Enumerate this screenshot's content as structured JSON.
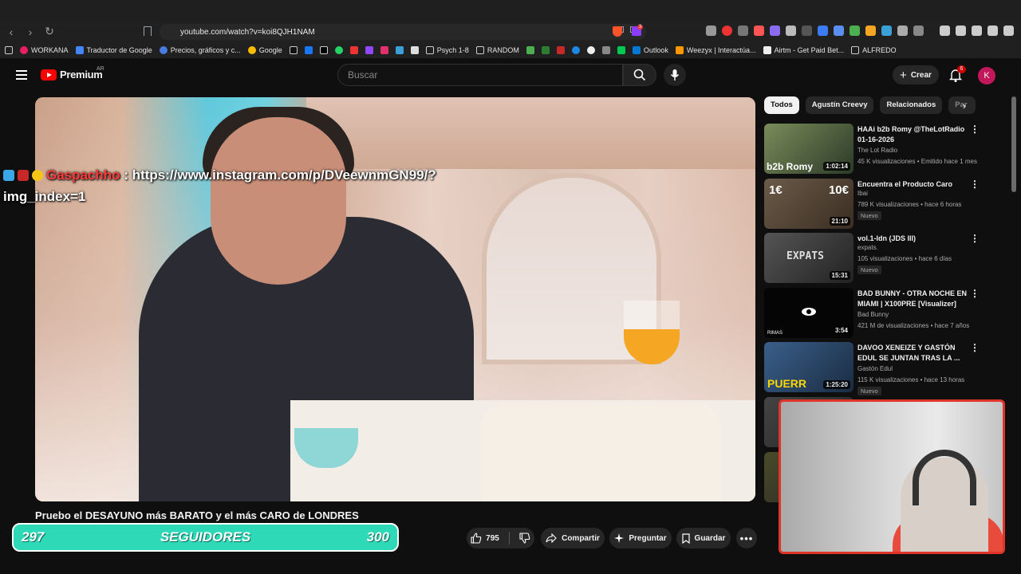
{
  "browser": {
    "url": "youtube.com/watch?v=koi8QJH1NAM",
    "bookmarks": [
      "WORKANA",
      "Traductor de Google",
      "Precios, gráficos y c...",
      "Google",
      "Psych 1-8",
      "RANDOM",
      "Outlook",
      "Weezyx | Interactúa...",
      "Airtm - Get Paid Bet...",
      "ALFREDO"
    ],
    "ext_badge": "3"
  },
  "header": {
    "logo_text": "Premium",
    "country": "AR",
    "search_placeholder": "Buscar",
    "create_label": "Crear",
    "notifications_count": "6",
    "avatar_letter": "K"
  },
  "player": {
    "chat_user": "Gaspachho",
    "chat_message": ": https://www.instagram.com/p/DVeewnmGN99/?",
    "chat_message_line2": "img_index=1"
  },
  "video": {
    "title": "Pruebo el DESAYUNO más BARATO y el más CARO de LONDRES",
    "likes": "795",
    "share_label": "Compartir",
    "ask_label": "Preguntar",
    "save_label": "Guardar"
  },
  "followers": {
    "current": "297",
    "label": "SEGUIDORES",
    "goal": "300"
  },
  "chips": [
    "Todos",
    "Agustín Creevy",
    "Relacionados",
    "Par"
  ],
  "recommendations": [
    {
      "title": "HAAi b2b Romy @TheLotRadio 01-16-2026",
      "channel": "The Lot Radio",
      "meta": "45 K visualizaciones • Emitido hace 1 mes",
      "duration": "1:02:14",
      "badge": "",
      "thumb_color": "#3a5a3a"
    },
    {
      "title": "Encuentra el Producto Caro",
      "channel": "Ibai",
      "meta": "789 K visualizaciones • hace 6 horas",
      "duration": "21:10",
      "badge": "Nuevo",
      "thumb_color": "#5b4a3a"
    },
    {
      "title": "vol.1-ldn (JDS III)",
      "channel": "expats.",
      "meta": "105 visualizaciones • hace 6 días",
      "duration": "15:31",
      "badge": "Nuevo",
      "thumb_color": "#3b3b3b"
    },
    {
      "title": "BAD BUNNY - OTRA NOCHE EN MIAMI | X100PRE [Visualizer]",
      "channel": "Bad Bunny",
      "meta": "421 M de visualizaciones • hace 7 años",
      "duration": "3:54",
      "badge": "",
      "thumb_color": "#050505"
    },
    {
      "title": "DAVOO XENEIZE Y GASTÓN EDUL SE JUNTAN TRAS LA ...",
      "channel": "Gastón Edul",
      "meta": "115 K visualizaciones • hace 13 horas",
      "duration": "1:25:20",
      "badge": "Nuevo",
      "thumb_color": "#2f4a6b"
    }
  ],
  "colors": {
    "accent": "#ff0000",
    "follow_bar": "#2ed9b8",
    "cam_border": "#e0342b"
  }
}
